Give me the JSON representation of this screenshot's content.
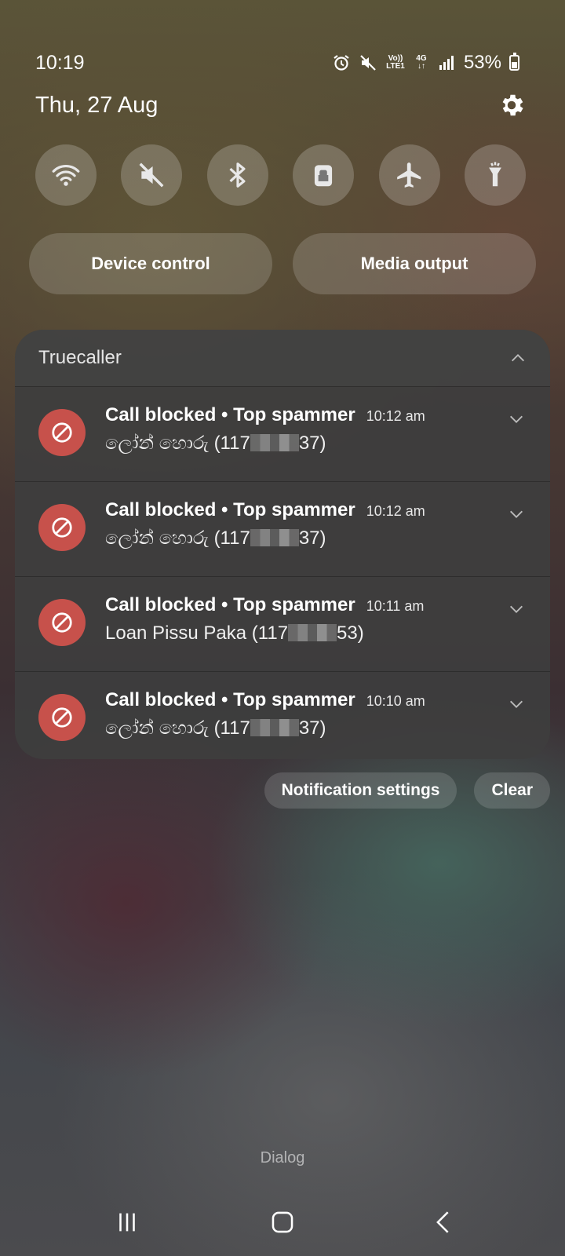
{
  "status": {
    "time": "10:19",
    "battery": "53%",
    "network_top": "Vo)) LTE1",
    "network_type": "4G"
  },
  "header": {
    "date": "Thu, 27 Aug"
  },
  "quick_settings": [
    {
      "name": "wifi",
      "icon": "wifi-icon"
    },
    {
      "name": "sound",
      "icon": "mute-icon"
    },
    {
      "name": "bluetooth",
      "icon": "bluetooth-icon"
    },
    {
      "name": "secure-folder",
      "icon": "lock-icon"
    },
    {
      "name": "airplane",
      "icon": "airplane-icon"
    },
    {
      "name": "flashlight",
      "icon": "flashlight-icon"
    }
  ],
  "pills": {
    "device_control": "Device control",
    "media_output": "Media output"
  },
  "notification_group": {
    "app": "Truecaller",
    "items": [
      {
        "title": "Call blocked • Top spammer",
        "time": "10:12 am",
        "name": "ලෝන් හොරු (117",
        "suffix": "37)"
      },
      {
        "title": "Call blocked • Top spammer",
        "time": "10:12 am",
        "name": "ලෝන් හොරු (117",
        "suffix": "37)"
      },
      {
        "title": "Call blocked • Top spammer",
        "time": "10:11 am",
        "name": "Loan Pissu Paka (117",
        "suffix": "53)"
      },
      {
        "title": "Call blocked • Top spammer",
        "time": "10:10 am",
        "name": "ලෝන් හොරු (117",
        "suffix": "37)"
      }
    ]
  },
  "actions": {
    "notification_settings": "Notification settings",
    "clear": "Clear"
  },
  "carrier": "Dialog",
  "colors": {
    "blocked_icon": "#c7514b",
    "panel": "#3e3e3e"
  }
}
